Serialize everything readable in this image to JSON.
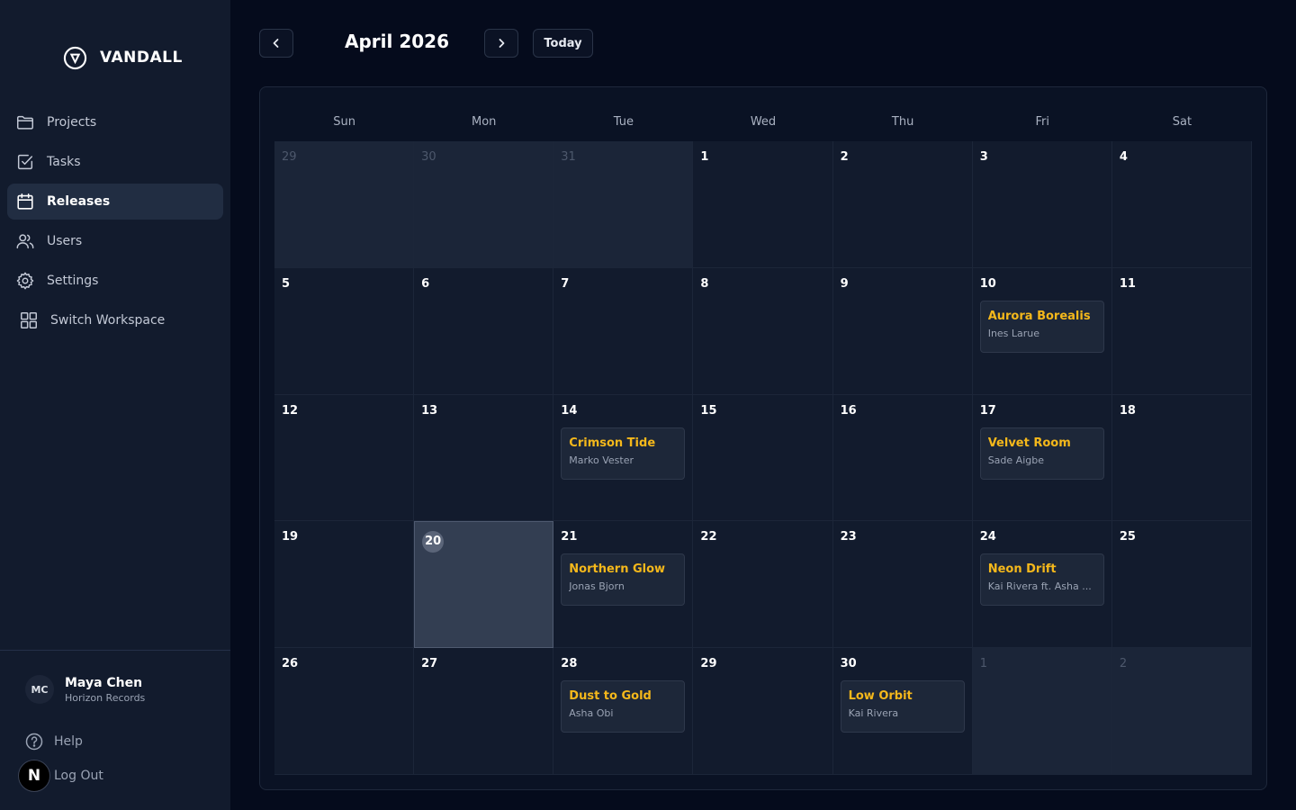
{
  "app": {
    "brand": "VANDALL"
  },
  "sidebar": {
    "items": [
      {
        "label": "Projects",
        "icon": "folder-icon"
      },
      {
        "label": "Tasks",
        "icon": "checkbox-icon"
      },
      {
        "label": "Releases",
        "icon": "calendar-icon",
        "active": true
      },
      {
        "label": "Users",
        "icon": "users-icon"
      },
      {
        "label": "Settings",
        "icon": "gear-icon"
      },
      {
        "label": "Switch Workspace",
        "icon": "grid-icon"
      }
    ],
    "user": {
      "initials": "MC",
      "name": "Maya Chen",
      "org": "Horizon Records"
    },
    "footer": {
      "help": "Help",
      "logout": "Log Out",
      "badge": "N"
    }
  },
  "header": {
    "month": "April 2026",
    "today_label": "Today"
  },
  "calendar": {
    "weekdays": [
      "Sun",
      "Mon",
      "Tue",
      "Wed",
      "Thu",
      "Fri",
      "Sat"
    ],
    "weeks": [
      [
        {
          "day": "29",
          "other": true
        },
        {
          "day": "30",
          "other": true
        },
        {
          "day": "31",
          "other": true
        },
        {
          "day": "1"
        },
        {
          "day": "2"
        },
        {
          "day": "3"
        },
        {
          "day": "4"
        }
      ],
      [
        {
          "day": "5"
        },
        {
          "day": "6"
        },
        {
          "day": "7"
        },
        {
          "day": "8"
        },
        {
          "day": "9"
        },
        {
          "day": "10",
          "event": {
            "title": "Aurora Borealis",
            "artist": "Ines Larue"
          }
        },
        {
          "day": "11"
        }
      ],
      [
        {
          "day": "12"
        },
        {
          "day": "13"
        },
        {
          "day": "14",
          "event": {
            "title": "Crimson Tide",
            "artist": "Marko Vester"
          }
        },
        {
          "day": "15"
        },
        {
          "day": "16"
        },
        {
          "day": "17",
          "event": {
            "title": "Velvet Room",
            "artist": "Sade Aigbe"
          }
        },
        {
          "day": "18"
        }
      ],
      [
        {
          "day": "19"
        },
        {
          "day": "20",
          "today": true
        },
        {
          "day": "21",
          "event": {
            "title": "Northern Glow",
            "artist": "Jonas Bjorn"
          }
        },
        {
          "day": "22"
        },
        {
          "day": "23"
        },
        {
          "day": "24",
          "event": {
            "title": "Neon Drift",
            "artist": "Kai Rivera ft. Asha ..."
          }
        },
        {
          "day": "25"
        }
      ],
      [
        {
          "day": "26"
        },
        {
          "day": "27"
        },
        {
          "day": "28",
          "event": {
            "title": "Dust to Gold",
            "artist": "Asha Obi"
          }
        },
        {
          "day": "29"
        },
        {
          "day": "30",
          "event": {
            "title": "Low Orbit",
            "artist": "Kai Rivera"
          }
        },
        {
          "day": "1",
          "other": true
        },
        {
          "day": "2",
          "other": true
        }
      ]
    ]
  },
  "colors": {
    "accent": "#f5b81b",
    "background": "#050b1c",
    "sidebar": "#121b2d"
  }
}
